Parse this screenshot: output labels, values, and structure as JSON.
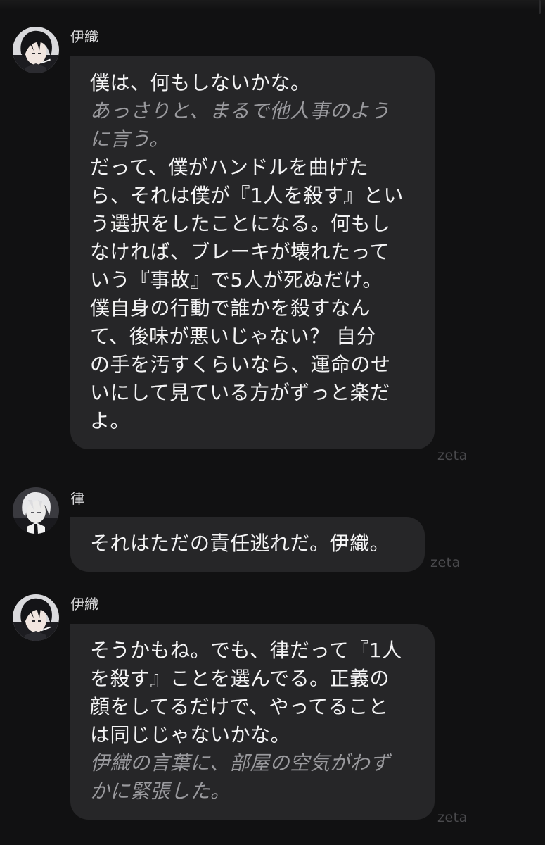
{
  "messages": [
    {
      "sender": "伊織",
      "lines": [
        {
          "type": "speech",
          "text": "僕は、何もしないかな。"
        },
        {
          "type": "action",
          "text": "あっさりと、まるで他人事のよう\nに言う。"
        },
        {
          "type": "speech",
          "text": "だって、僕がハンドルを曲げた\nら、それは僕が『1人を殺す』とい\nう選択をしたことになる。何もし\nなければ、ブレーキが壊れたって\nいう『事故』で5人が死ぬだけ。\n僕自身の行動で誰かを殺すなん\nて、後味が悪いじゃない？ 自分\nの手を汚すくらいなら、運命のせ\nいにして見ている方がずっと楽だ\nよ。"
        }
      ],
      "watermark": "zeta"
    },
    {
      "sender": "律",
      "lines": [
        {
          "type": "speech",
          "text": "それはただの責任逃れだ。伊織。"
        }
      ],
      "watermark": "zeta"
    },
    {
      "sender": "伊織",
      "lines": [
        {
          "type": "speech",
          "text": "そうかもね。でも、律だって『1人\nを殺す』ことを選んでる。正義の\n顔をしてるだけで、やってること\nは同じじゃないかな。"
        },
        {
          "type": "action",
          "text": "伊織の言葉に、部屋の空気がわず\nかに緊張した。"
        }
      ],
      "watermark": "zeta"
    }
  ],
  "avatars": {
    "iori": "dark-haired-character-avatar",
    "ritsu": "white-haired-character-avatar"
  },
  "colors": {
    "background": "#111112",
    "bubble": "#262628",
    "speech_text": "#f4f4f5",
    "action_text": "#9a9a9e",
    "name_text": "#d8d8da",
    "watermark": "#4a4a4d"
  }
}
